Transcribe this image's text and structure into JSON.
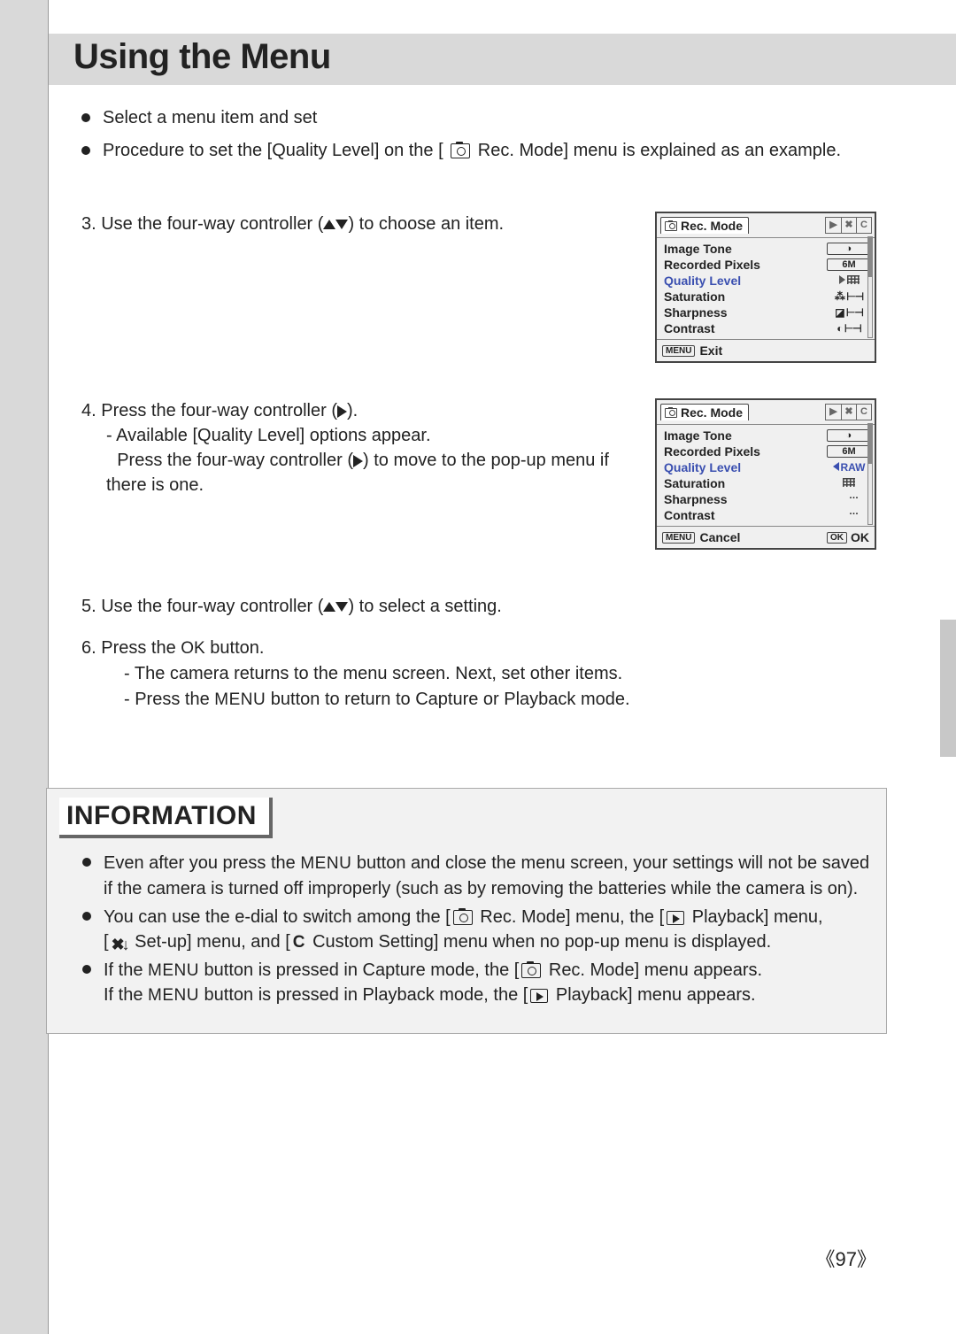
{
  "page": {
    "title": "Using the Menu",
    "number": "《97》"
  },
  "intro": {
    "b1": "Select a menu item and set",
    "b2_a": "Procedure to set the [Quality Level] on the [",
    "b2_b": " Rec. Mode] menu is explained as an example."
  },
  "steps": {
    "s3_a": "3. Use the four-way controller (",
    "s3_b": ") to choose an item.",
    "s4_a": "4. Press the four-way controller (",
    "s4_b": ").",
    "s4_sub1": "- Available [Quality Level] options appear.",
    "s4_sub2_a": "Press the four-way controller (",
    "s4_sub2_b": ") to move to the pop-up menu if there is one.",
    "s5_a": "5. Use the four-way controller (",
    "s5_b": ") to select a setting.",
    "s6_a": "6. Press the ",
    "s6_ok": "OK",
    "s6_b": " button.",
    "s6_sub1": "- The camera returns to the menu screen. Next, set other items.",
    "s6_sub2_a": "- Press the ",
    "s6_menu": "MENU",
    "s6_sub2_b": " button to return to Capture or Playback mode."
  },
  "lcd1": {
    "header": "Rec. Mode",
    "tabs": [
      "▶",
      "✖",
      "C"
    ],
    "rows": {
      "r1": {
        "label": "Image Tone"
      },
      "r2": {
        "label": "Recorded Pixels",
        "val": "6M"
      },
      "r3": {
        "label": "Quality Level"
      },
      "r4": {
        "label": "Saturation"
      },
      "r5": {
        "label": "Sharpness"
      },
      "r6": {
        "label": "Contrast"
      }
    },
    "footer": "Exit",
    "menuTag": "MENU"
  },
  "lcd2": {
    "header": "Rec. Mode",
    "tabs": [
      "▶",
      "✖",
      "C"
    ],
    "rows": {
      "r1": {
        "label": "Image Tone"
      },
      "r2": {
        "label": "Recorded Pixels",
        "val": "6M"
      },
      "r3": {
        "label": "Quality Level",
        "val": "RAW"
      },
      "r4": {
        "label": "Saturation"
      },
      "r5": {
        "label": "Sharpness"
      },
      "r6": {
        "label": "Contrast"
      }
    },
    "footer_left": "Cancel",
    "footer_right": "OK",
    "menuTag": "MENU",
    "okTag": "OK"
  },
  "info": {
    "title": "INFORMATION",
    "b1_a": "Even after you press the ",
    "b1_menu": "MENU",
    "b1_b": " button and close the menu screen, your settings will not be saved if the camera is turned off improperly (such as by removing the batteries while the camera is on).",
    "b2_a": "You can use the e-dial to switch among the [",
    "b2_b": " Rec. Mode] menu, the [",
    "b2_c": " Playback] menu,",
    "b2_d": "[",
    "b2_tools": "",
    "b2_e": " Set-up] menu, and [",
    "b2_f": " Custom Setting] menu when no pop-up menu is displayed.",
    "b3_a": "If the ",
    "b3_menu": "MENU",
    "b3_b": " button is pressed in Capture mode, the [",
    "b3_c": " Rec. Mode] menu appears.",
    "b3_d": "If the ",
    "b3_menu2": "MENU",
    "b3_e": " button is pressed in Playback mode, the [",
    "b3_f": " Playback] menu appears."
  }
}
